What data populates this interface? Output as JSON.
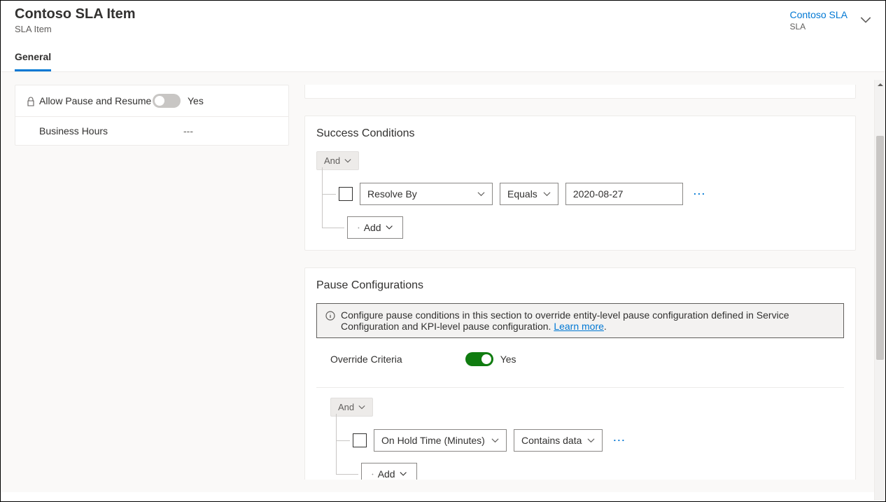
{
  "header": {
    "title": "Contoso SLA Item",
    "subtitle": "SLA Item",
    "linked": {
      "name": "Contoso SLA",
      "type": "SLA"
    }
  },
  "tabs": [
    "General"
  ],
  "leftForm": {
    "allowPauseResume": {
      "label": "Allow Pause and Resume",
      "value": "Yes"
    },
    "businessHours": {
      "label": "Business Hours",
      "value": "---"
    }
  },
  "successConditions": {
    "title": "Success Conditions",
    "logic": "And",
    "row": {
      "field": "Resolve By",
      "operator": "Equals",
      "value": "2020-08-27"
    },
    "addLabel": "Add"
  },
  "pauseConfig": {
    "title": "Pause Configurations",
    "infoText": "Configure pause conditions in this section to override entity-level pause configuration defined in Service Configuration and KPI-level pause configuration. ",
    "learnMore": "Learn more",
    "overrideLabel": "Override Criteria",
    "overrideValue": "Yes",
    "logic": "And",
    "row": {
      "field": "On Hold Time (Minutes)",
      "operator": "Contains data"
    },
    "addLabel": "Add"
  }
}
